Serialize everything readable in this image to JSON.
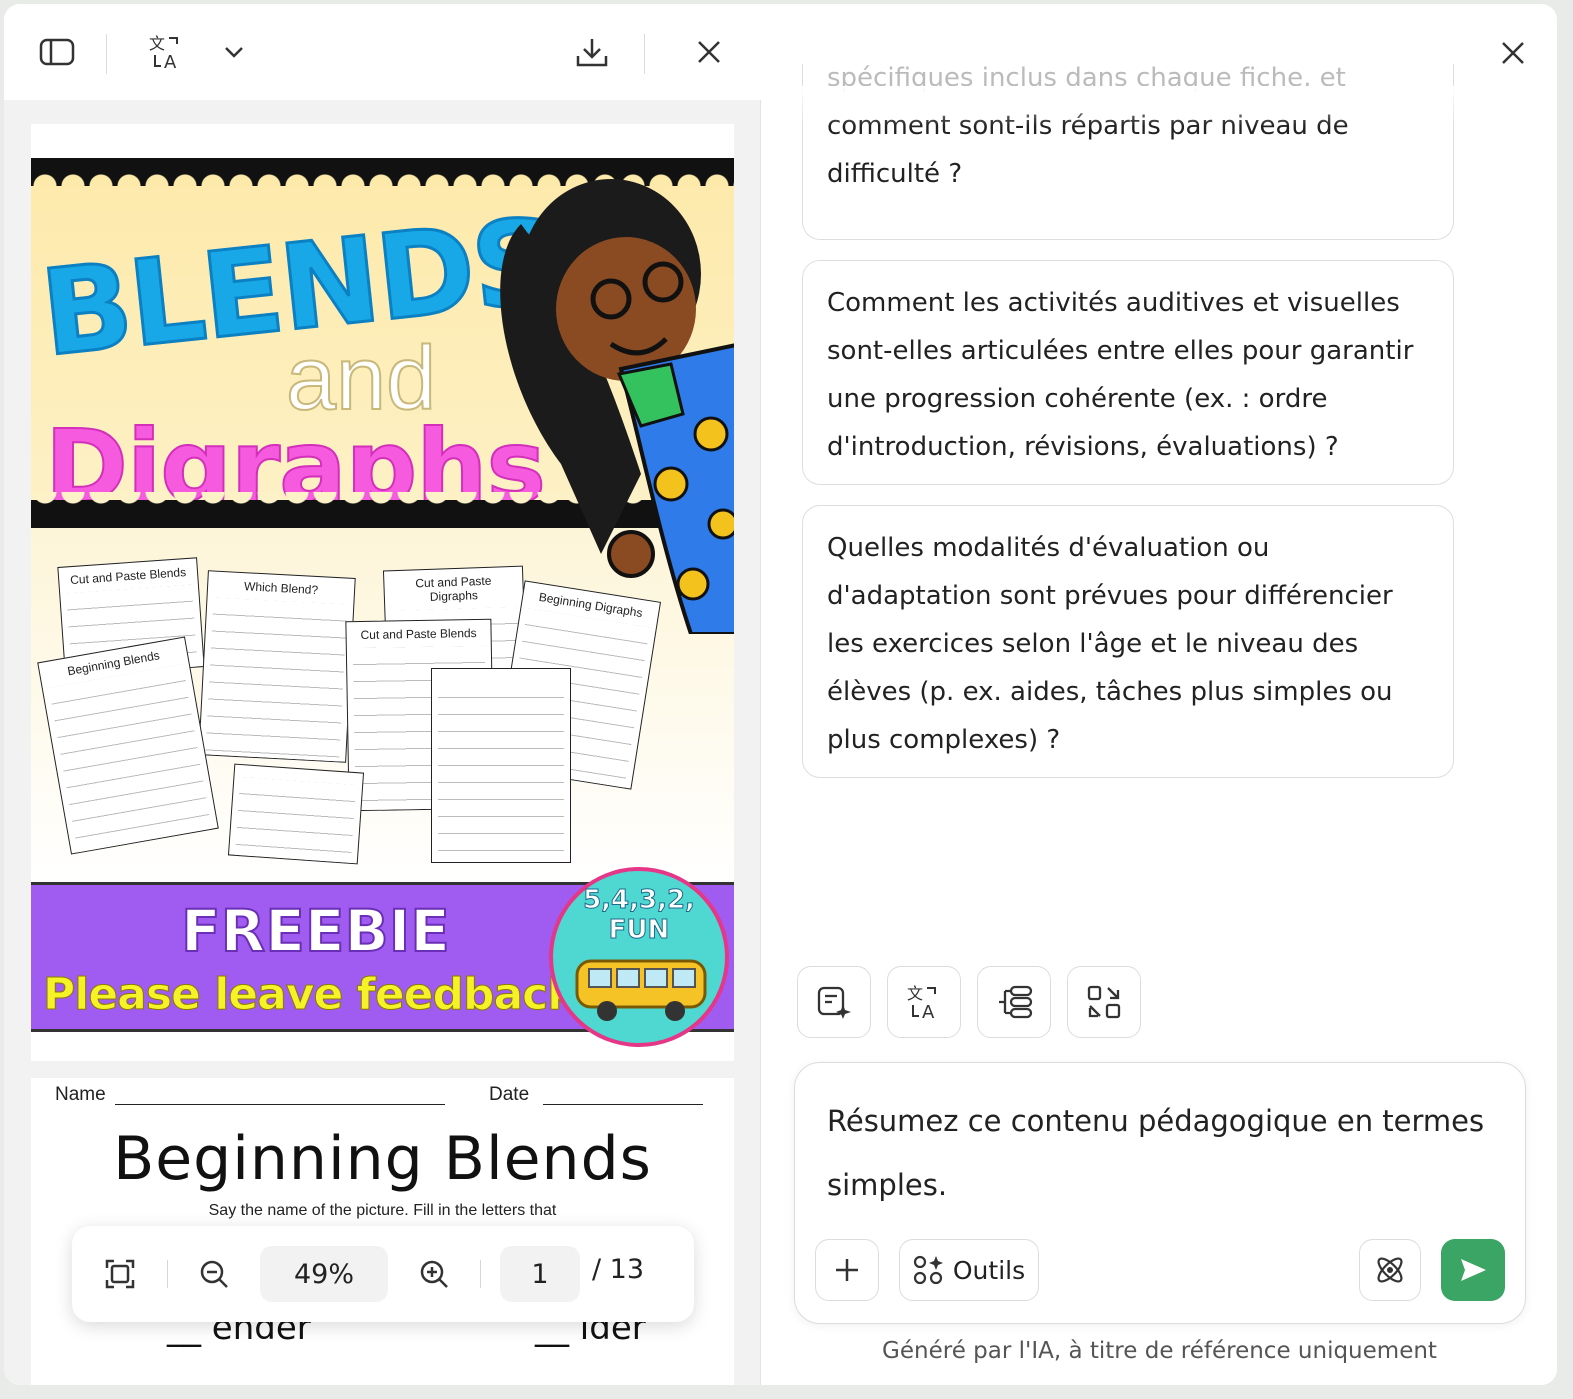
{
  "left_toolbar": {
    "icons": [
      "sidebar-toggle-icon",
      "translate-icon",
      "chevron-down-icon",
      "download-icon",
      "close-icon"
    ]
  },
  "document": {
    "cover": {
      "title_line1": "BLENDS",
      "title_line2": "and",
      "title_line3": "Digraphs",
      "worksheets": [
        {
          "title": "Cut and Paste Blends"
        },
        {
          "title": "Which Blend?"
        },
        {
          "title": "Cut and Paste Digraphs"
        },
        {
          "title": "Beginning Digraphs"
        },
        {
          "title": "Beginning Blends"
        },
        {
          "title": "Cut and Paste Blends"
        }
      ],
      "banner_main": "FREEBIE",
      "banner_sub": "Please leave feedback",
      "badge": "5,4,3,2, FUN"
    },
    "page2": {
      "name_label": "Name",
      "date_label": "Date",
      "title": "Beginning Blends",
      "instructions": "Say the name of the picture. Fill in the letters that",
      "row_left": "__ ender",
      "row_right": "__ ider"
    }
  },
  "zoom_bar": {
    "zoom": "49%",
    "current_page": "1",
    "total_pages": "/ 13"
  },
  "suggestions": {
    "card1_faded": "spécifiques inclus dans chaque fiche, et",
    "card1": "comment sont-ils répartis par niveau de difficulté ?",
    "card2": "Comment les activités auditives et visuelles sont-elles articulées entre elles pour garantir une progression cohérente (ex. : ordre d'introduction, révisions, évaluations) ?",
    "card3": "Quelles modalités d'évaluation ou d'adaptation sont prévues pour différencier les exercices selon l'âge et le niveau des élèves (p. ex. aides, tâches plus simples ou plus complexes) ?"
  },
  "quick_actions": [
    "summarize-icon",
    "translate-icon",
    "mind-map-icon",
    "convert-icon"
  ],
  "composer": {
    "text": "Résumez ce contenu pédagogique en termes simples.",
    "tools_label": "Outils"
  },
  "disclaimer": "Généré par l'IA, à titre de référence uniquement",
  "colors": {
    "send_button": "#3aa565",
    "blends_blue": "#18a8e8",
    "digraphs_pink": "#f65adf",
    "banner_purple": "#a05cf0",
    "feedback_yellow": "#f5f227"
  }
}
